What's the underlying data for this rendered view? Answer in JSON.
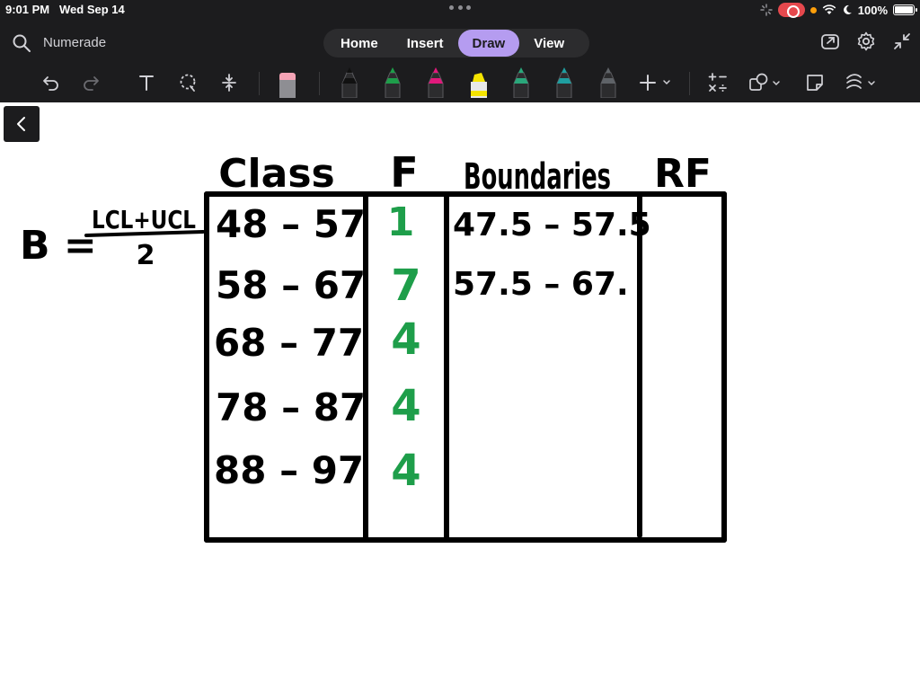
{
  "status_bar": {
    "time": "9:01 PM",
    "date": "Wed Sep 14",
    "battery": "100%"
  },
  "header": {
    "app_name": "Numerade",
    "tabs": [
      {
        "label": "Home",
        "active": false
      },
      {
        "label": "Insert",
        "active": false
      },
      {
        "label": "Draw",
        "active": true
      },
      {
        "label": "View",
        "active": false
      }
    ]
  },
  "toolbar": {
    "tools": [
      "undo-icon",
      "redo-icon",
      "text-icon",
      "lasso-icon",
      "space-icon",
      "eraser-icon",
      "pen-black-icon",
      "pen-green-icon",
      "pen-magenta-icon",
      "highlighter-yellow-icon",
      "pen-teal-icon",
      "pen-teal-dark-icon",
      "pen-gray-icon",
      "add-icon",
      "math-icon",
      "shapes-icon",
      "sticky-note-icon",
      "ink-style-icon"
    ],
    "pen_colors": [
      "#111111",
      "#1e9e4a",
      "#e0197c",
      "#f5e400",
      "#2aa77b",
      "#1f9ea0",
      "#5f6368"
    ]
  },
  "colors": {
    "accent": "#b59cf0",
    "chrome": "#1c1c1e",
    "ink_black": "#000000",
    "ink_green": "#1e9e4a"
  },
  "canvas": {
    "formula": {
      "lhs": "B =",
      "numerator": "LCL+UCL",
      "denominator": "2"
    },
    "headers": {
      "class": "Class",
      "f": "F",
      "boundaries": "Boundaries",
      "rf": "RF"
    },
    "rows": [
      {
        "class": "48 – 57",
        "f": "1",
        "boundaries": "47.5 – 57.5"
      },
      {
        "class": "58 – 67",
        "f": "7",
        "boundaries": "57.5 – 67."
      },
      {
        "class": "68 – 77",
        "f": "4",
        "boundaries": ""
      },
      {
        "class": "78 – 87",
        "f": "4",
        "boundaries": ""
      },
      {
        "class": "88 – 97",
        "f": "4",
        "boundaries": ""
      }
    ]
  }
}
